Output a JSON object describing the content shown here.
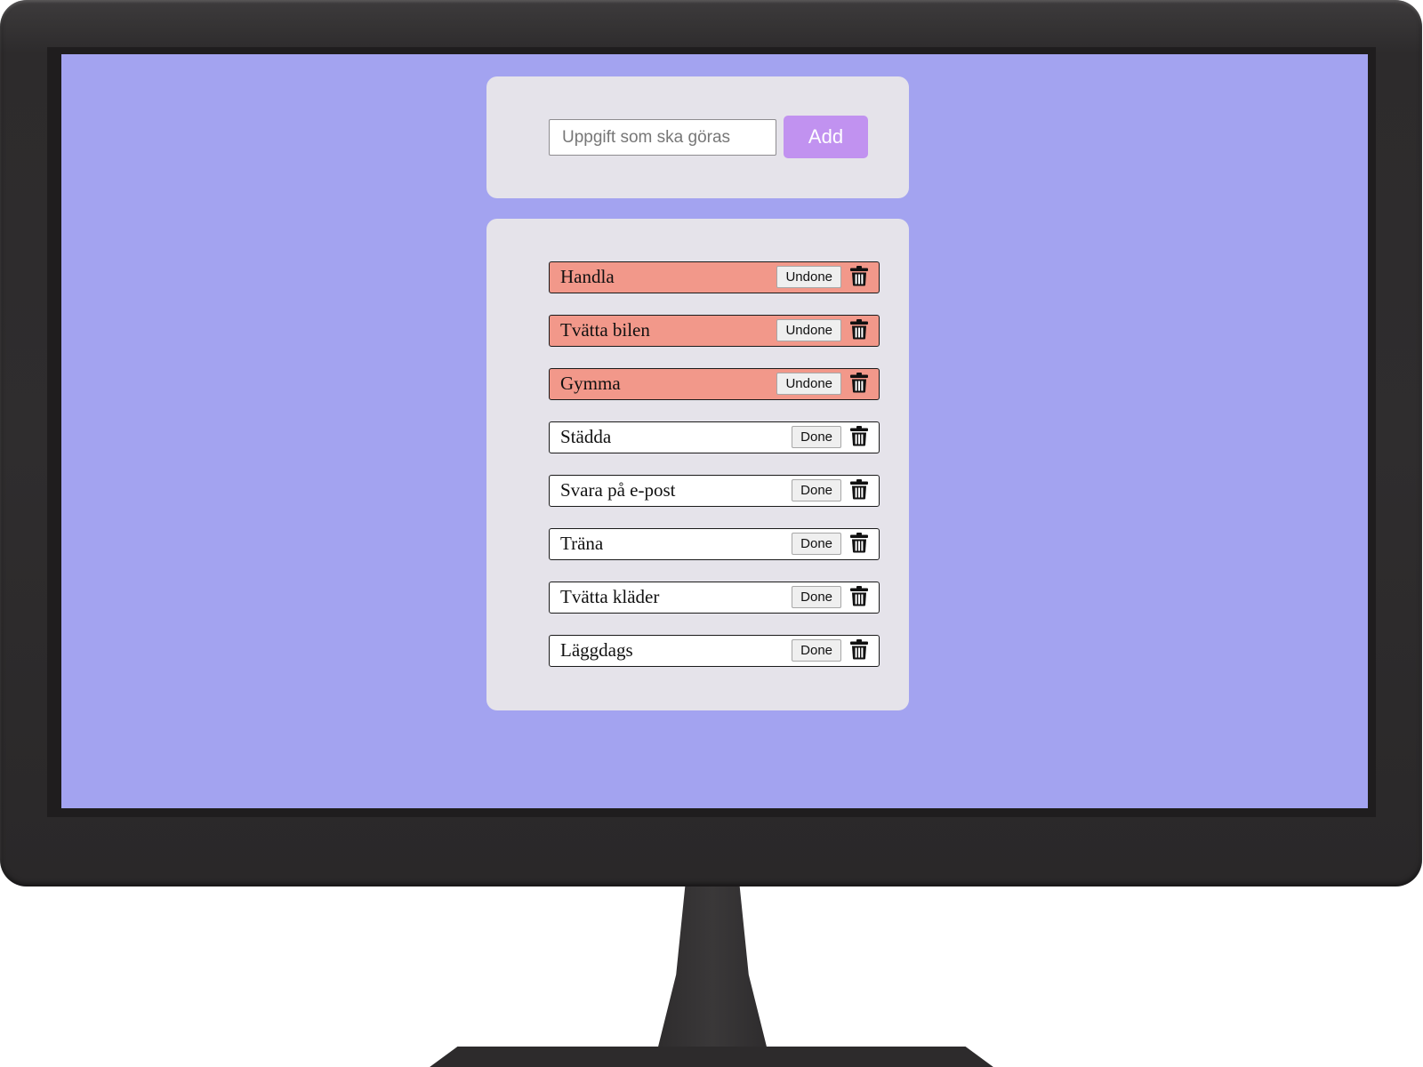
{
  "add_form": {
    "input_placeholder": "Uppgift som ska göras",
    "input_value": "",
    "add_label": "Add"
  },
  "tasks": [
    {
      "text": "Handla",
      "completed": true,
      "toggle_label": "Undone"
    },
    {
      "text": "Tvätta bilen",
      "completed": true,
      "toggle_label": "Undone"
    },
    {
      "text": "Gymma",
      "completed": true,
      "toggle_label": "Undone"
    },
    {
      "text": "Städda",
      "completed": false,
      "toggle_label": "Done"
    },
    {
      "text": "Svara på e-post",
      "completed": false,
      "toggle_label": "Done"
    },
    {
      "text": "Träna",
      "completed": false,
      "toggle_label": "Done"
    },
    {
      "text": "Tvätta kläder",
      "completed": false,
      "toggle_label": "Done"
    },
    {
      "text": "Läggdags",
      "completed": false,
      "toggle_label": "Done"
    }
  ],
  "icons": {
    "delete": "trash-icon"
  },
  "colors": {
    "screen_background": "#a3a3f0",
    "panel_background": "#e5e3ea",
    "add_button": "#c192f0",
    "completed_task": "#f2988a",
    "open_task": "#ffffff"
  }
}
